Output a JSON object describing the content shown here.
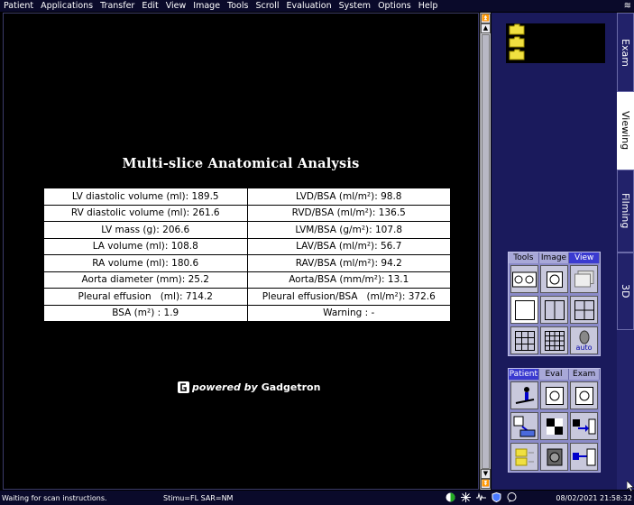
{
  "menubar": {
    "items": [
      "Patient",
      "Applications",
      "Transfer",
      "Edit",
      "View",
      "Image",
      "Tools",
      "Scroll",
      "Evaluation",
      "System",
      "Options",
      "Help"
    ]
  },
  "report": {
    "title": "Multi-slice Anatomical  Analysis",
    "rows": [
      [
        "LV diastolic volume (ml): 189.5",
        "LVD/BSA (ml/m²): 98.8"
      ],
      [
        "RV diastolic volume (ml): 261.6",
        "RVD/BSA (ml/m²): 136.5"
      ],
      [
        "LV mass (g): 206.6",
        "LVM/BSA (g/m²): 107.8"
      ],
      [
        "LA volume (ml): 108.8",
        "LAV/BSA (ml/m²): 56.7"
      ],
      [
        "RA volume (ml): 180.6",
        "RAV/BSA (ml/m²): 94.2"
      ],
      [
        "Aorta diameter (mm): 25.2",
        "Aorta/BSA (mm/m²): 13.1"
      ],
      [
        "Pleural effusion   (ml): 714.2",
        "Pleural effusion/BSA   (ml/m²): 372.6"
      ],
      [
        "BSA (m²) : 1.9",
        "Warning : -"
      ]
    ],
    "powered_by": "powered by",
    "brand": "Gadgetron"
  },
  "side_tabs": [
    {
      "label": "Exam",
      "active": false
    },
    {
      "label": "Viewing",
      "active": true
    },
    {
      "label": "Filming",
      "active": false
    },
    {
      "label": "3D",
      "active": false
    }
  ],
  "view_panel": {
    "tabs": [
      "Tools",
      "Image",
      "View"
    ],
    "active_tab": "View",
    "auto_label": "auto"
  },
  "patient_panel": {
    "tabs": [
      "Patient",
      "Eval",
      "Exam"
    ],
    "active_tab": "Patient"
  },
  "statusbar": {
    "message": "Waiting for scan instructions.",
    "stimulation": "Stimu=FL SAR=NM",
    "datetime": "08/02/2021 21:58:32"
  },
  "colors": {
    "panel_bg": "#1a1a5c",
    "active_tab": "#3a3ad0",
    "tool_bg": "#8a8ac8"
  }
}
